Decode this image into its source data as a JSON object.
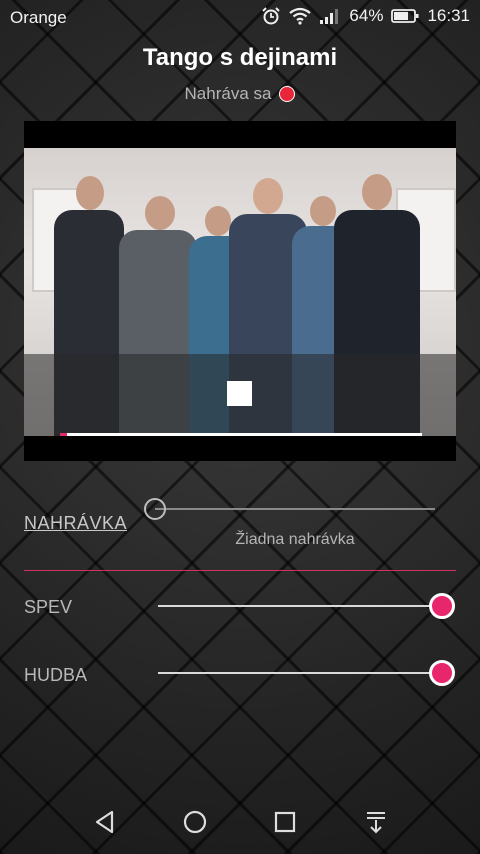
{
  "status_bar": {
    "carrier": "Orange",
    "battery_percent": "64%",
    "time": "16:31",
    "icons": [
      "alarm-icon",
      "wifi-icon",
      "signal-icon",
      "battery-icon"
    ]
  },
  "header": {
    "title": "Tango s dejinami",
    "recording_status": "Nahráva sa"
  },
  "video": {
    "progress": 0.02
  },
  "recording": {
    "label": "NAHRÁVKA",
    "empty_text": "Žiadna nahrávka",
    "slider_value": 0
  },
  "mix": {
    "vocals": {
      "label": "SPEV",
      "value": 1.0
    },
    "music": {
      "label": "HUDBA",
      "value": 1.0
    }
  },
  "nav": [
    "back-icon",
    "home-icon",
    "recents-icon",
    "notification-pull-icon"
  ],
  "colors": {
    "accent": "#e8266b",
    "record": "#e8263a",
    "background": "#262626"
  }
}
